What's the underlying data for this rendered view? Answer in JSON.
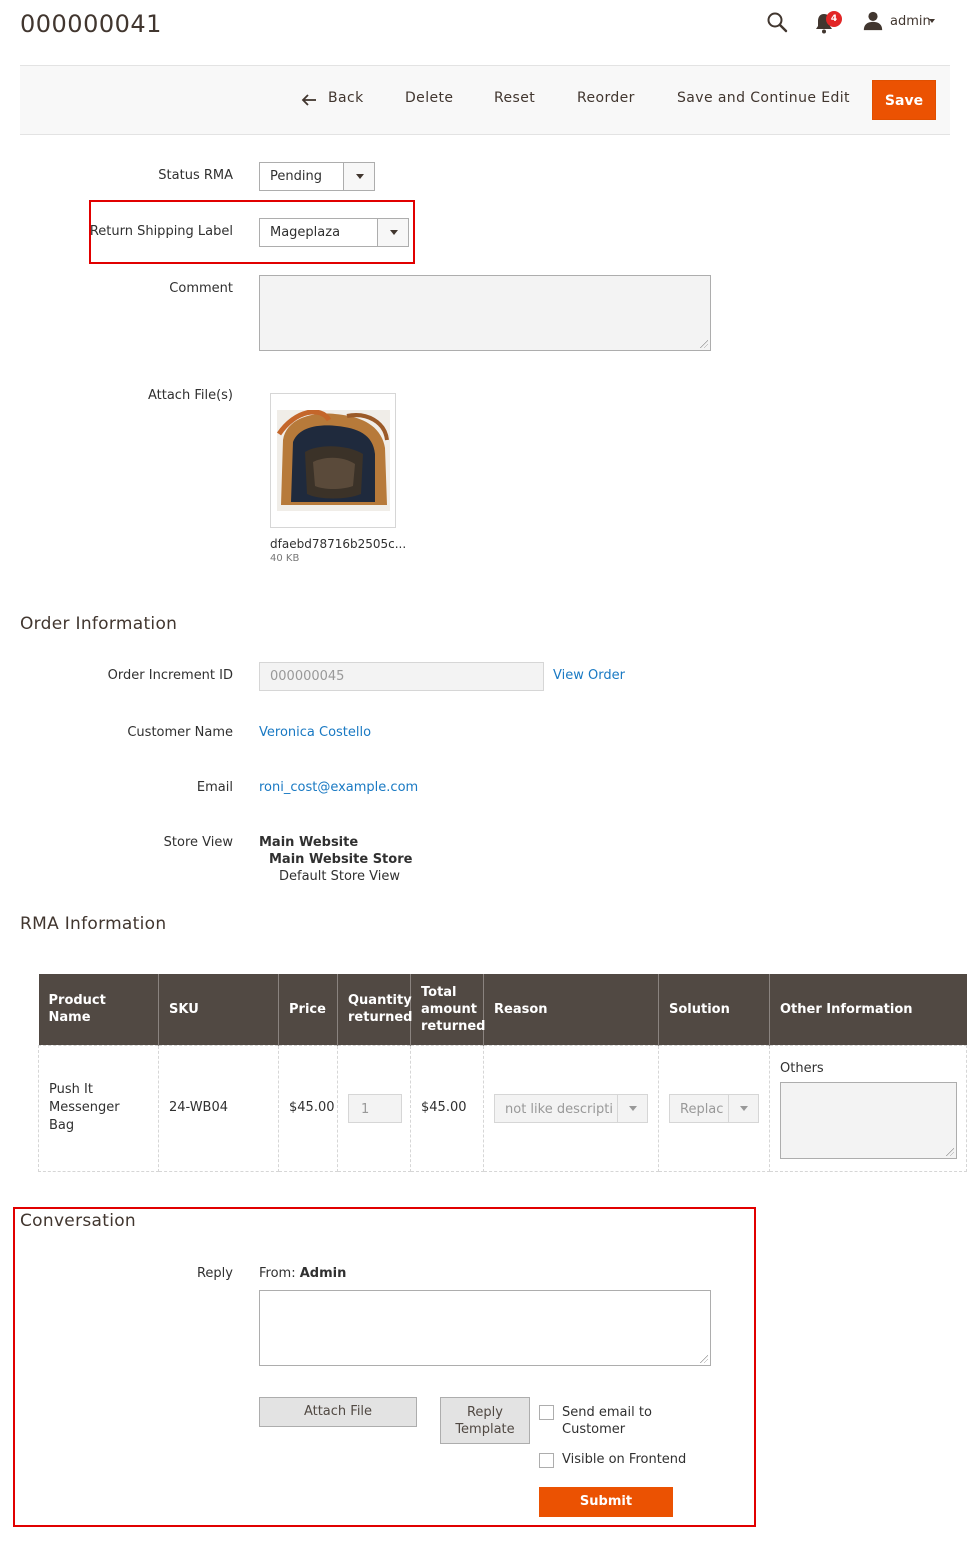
{
  "header": {
    "title": "000000041",
    "notification_count": "4",
    "admin_name": "admin"
  },
  "actions": {
    "back": "Back",
    "delete": "Delete",
    "reset": "Reset",
    "reorder": "Reorder",
    "save_continue": "Save and Continue Edit",
    "save": "Save"
  },
  "form": {
    "status_label": "Status RMA",
    "status_value": "Pending",
    "return_label_label": "Return Shipping Label",
    "return_label_value": "Mageplaza",
    "comment_label": "Comment",
    "attach_label": "Attach File(s)",
    "file_name": "dfaebd78716b2505c...",
    "file_size": "40 KB"
  },
  "order_info": {
    "title": "Order Information",
    "increment_label": "Order Increment ID",
    "increment_value": "000000045",
    "view_order": "View Order",
    "customer_label": "Customer Name",
    "customer_value": "Veronica Costello",
    "email_label": "Email",
    "email_value": "roni_cost@example.com",
    "store_label": "Store View",
    "store_website": "Main Website",
    "store_store": "Main Website Store",
    "store_view": "Default Store View"
  },
  "rma_info": {
    "title": "RMA Information",
    "columns": [
      "Product Name",
      "SKU",
      "Price",
      "Quantity returned",
      "Total amount returned",
      "Reason",
      "Solution",
      "Other Information"
    ],
    "row": {
      "product_name": "Push It Messenger Bag",
      "sku": "24-WB04",
      "price": "$45.00",
      "quantity": "1",
      "total": "$45.00",
      "reason": "not like description",
      "solution": "Replace",
      "other_label": "Others"
    }
  },
  "conversation": {
    "title": "Conversation",
    "reply_label": "Reply",
    "from_prefix": "From:",
    "from_name": "Admin",
    "attach_file": "Attach File",
    "reply_template": "Reply Template",
    "send_email": "Send email to Customer",
    "visible_frontend": "Visible on Frontend",
    "submit": "Submit"
  },
  "colors": {
    "accent": "#eb5202",
    "table_header": "#514943",
    "link": "#1979c3",
    "highlight": "#e10000"
  }
}
